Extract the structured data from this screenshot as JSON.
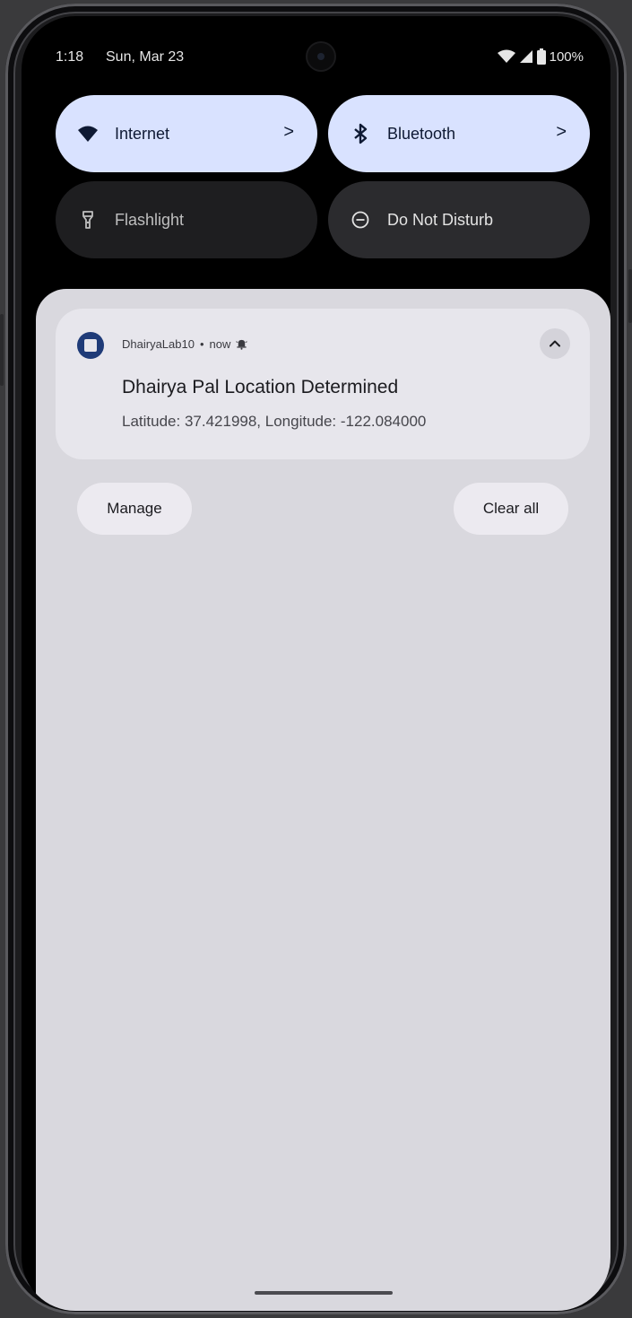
{
  "status_bar": {
    "time": "1:18",
    "date": "Sun, Mar 23",
    "battery": "100%",
    "icons": [
      "wifi-icon",
      "cellular-signal-icon",
      "battery-icon"
    ]
  },
  "quick_settings": {
    "tiles": [
      {
        "label": "Internet",
        "icon": "wifi-icon",
        "state": "on"
      },
      {
        "label": "Bluetooth",
        "icon": "bluetooth-icon",
        "state": "on"
      },
      {
        "label": "Flashlight",
        "icon": "flashlight-icon",
        "state": "off"
      },
      {
        "label": "Do Not Disturb",
        "icon": "do-not-disturb-icon",
        "state": "off"
      }
    ],
    "chevron": ">"
  },
  "notification": {
    "app_name": "DhairyaLab10",
    "separator": "•",
    "time": "now",
    "title": "Dhairya Pal Location Determined",
    "text": "Latitude: 37.421998, Longitude: -122.084000"
  },
  "shade_actions": {
    "manage_label": "Manage",
    "clear_all_label": "Clear all"
  },
  "colors": {
    "tile_on_bg": "#d9e2ff",
    "tile_off_bg": "#1e1e20",
    "shade_bg": "#d9d8de",
    "notification_bg": "#e7e6ec",
    "app_icon": "#1f3b78"
  }
}
